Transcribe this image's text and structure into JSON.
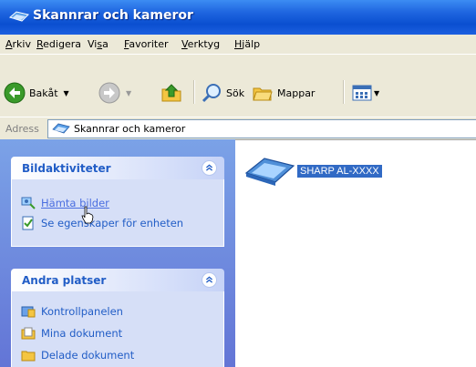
{
  "window": {
    "title": "Skannrar och kameror"
  },
  "menu": {
    "items": [
      {
        "u": "A",
        "rest": "rkiv"
      },
      {
        "u": "R",
        "rest": "edigera"
      },
      {
        "pre": "Vi",
        "u": "s",
        "rest": "a"
      },
      {
        "u": "F",
        "rest": "avoriter"
      },
      {
        "u": "V",
        "rest": "erktyg"
      },
      {
        "u": "H",
        "rest": "jälp"
      }
    ]
  },
  "toolbar": {
    "back_label": "Bakåt",
    "search_label": "Sök",
    "folders_label": "Mappar"
  },
  "address": {
    "label": "Adress",
    "value": "Skannrar och kameror"
  },
  "panels": {
    "picture_tasks": {
      "title": "Bildaktiviteter",
      "items": [
        "Hämta bilder",
        "Se egenskaper för enheten"
      ]
    },
    "other_places": {
      "title": "Andra platser",
      "items": [
        "Kontrollpanelen",
        "Mina dokument",
        "Delade dokument"
      ]
    }
  },
  "content": {
    "device_label": "SHARP AL-XXXX"
  },
  "colors": {
    "title_bar": "#0a4fd0",
    "task_pane": "#6f8fe0",
    "panel_title_text": "#215dc6",
    "selection": "#316ac5"
  }
}
